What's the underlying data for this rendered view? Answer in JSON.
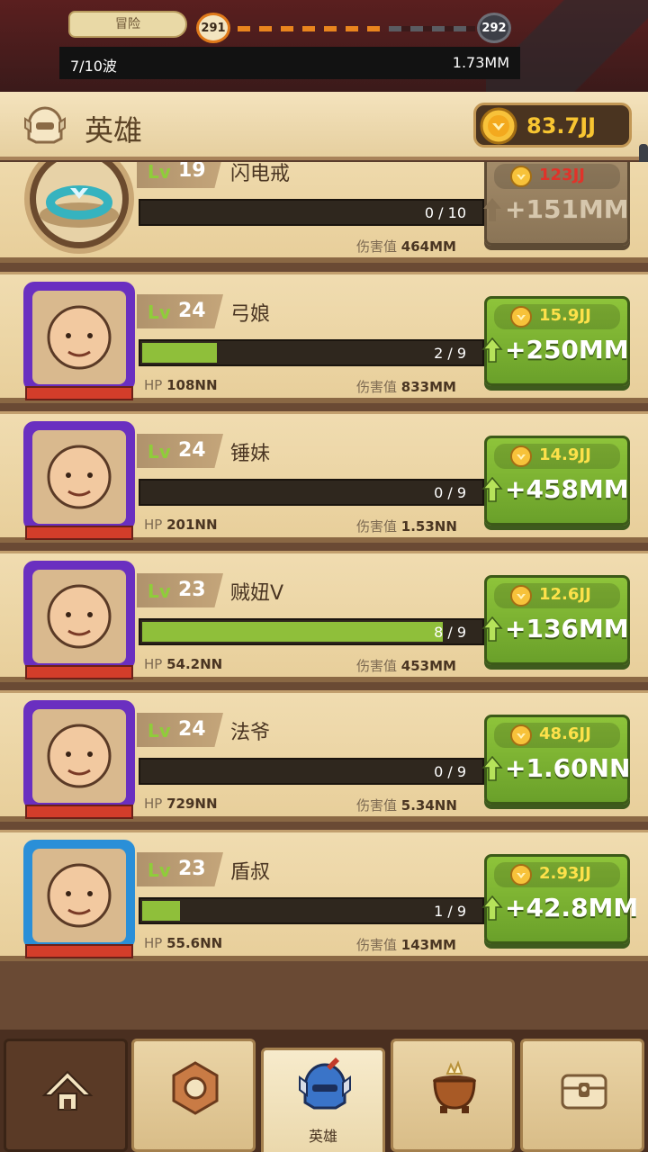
{
  "topbar": {
    "adventure_label": "冒险",
    "current_stage": "291",
    "next_stage": "292",
    "wave": "7/10波",
    "hp": "1.73MM"
  },
  "header": {
    "title": "英雄",
    "gold": "83.7JJ"
  },
  "items": [
    {
      "lv_label": "Lv",
      "level": "19",
      "name": "闪电戒",
      "xp": "0 / 10",
      "xp_fill": 0,
      "damage_label": "伤害值",
      "damage": "464MM",
      "cost": "123JJ",
      "gain": "+151MM",
      "disabled": true,
      "portrait": "ring-icon"
    }
  ],
  "heroes": [
    {
      "lv_label": "Lv",
      "level": "24",
      "name": "弓娘",
      "xp": "2 / 9",
      "xp_fill": 0.222,
      "hp_label": "HP",
      "hp": "108NN",
      "damage_label": "伤害值",
      "damage": "833MM",
      "cost": "15.9JJ",
      "gain": "+250MM",
      "frame": "#6a2fc0",
      "portrait": "archer-girl-portrait"
    },
    {
      "lv_label": "Lv",
      "level": "24",
      "name": "锤妹",
      "xp": "0 / 9",
      "xp_fill": 0,
      "hp_label": "HP",
      "hp": "201NN",
      "damage_label": "伤害值",
      "damage": "1.53NN",
      "cost": "14.9JJ",
      "gain": "+458MM",
      "frame": "#6a2fc0",
      "portrait": "hammer-girl-portrait"
    },
    {
      "lv_label": "Lv",
      "level": "23",
      "name": "贼妞V",
      "xp": "8 / 9",
      "xp_fill": 0.889,
      "hp_label": "HP",
      "hp": "54.2NN",
      "damage_label": "伤害值",
      "damage": "453MM",
      "cost": "12.6JJ",
      "gain": "+136MM",
      "frame": "#6a2fc0",
      "portrait": "thief-girl-portrait"
    },
    {
      "lv_label": "Lv",
      "level": "24",
      "name": "法爷",
      "xp": "0 / 9",
      "xp_fill": 0,
      "hp_label": "HP",
      "hp": "729NN",
      "damage_label": "伤害值",
      "damage": "5.34NN",
      "cost": "48.6JJ",
      "gain": "+1.60NN",
      "frame": "#6a2fc0",
      "portrait": "wizard-portrait"
    },
    {
      "lv_label": "Lv",
      "level": "23",
      "name": "盾叔",
      "xp": "1 / 9",
      "xp_fill": 0.111,
      "hp_label": "HP",
      "hp": "55.6NN",
      "damage_label": "伤害值",
      "damage": "143MM",
      "cost": "2.93JJ",
      "gain": "+42.8MM",
      "frame": "#2a8fd8",
      "portrait": "shield-uncle-portrait"
    }
  ],
  "nav": {
    "active_label": "英雄",
    "icons": [
      "camp-icon",
      "gear-icon",
      "helmet-icon",
      "cauldron-icon",
      "treasure-chest-icon"
    ]
  },
  "colors": {
    "accent_green": "#8ec43a",
    "gold": "#f8c531",
    "cost_red": "#e0332a"
  }
}
